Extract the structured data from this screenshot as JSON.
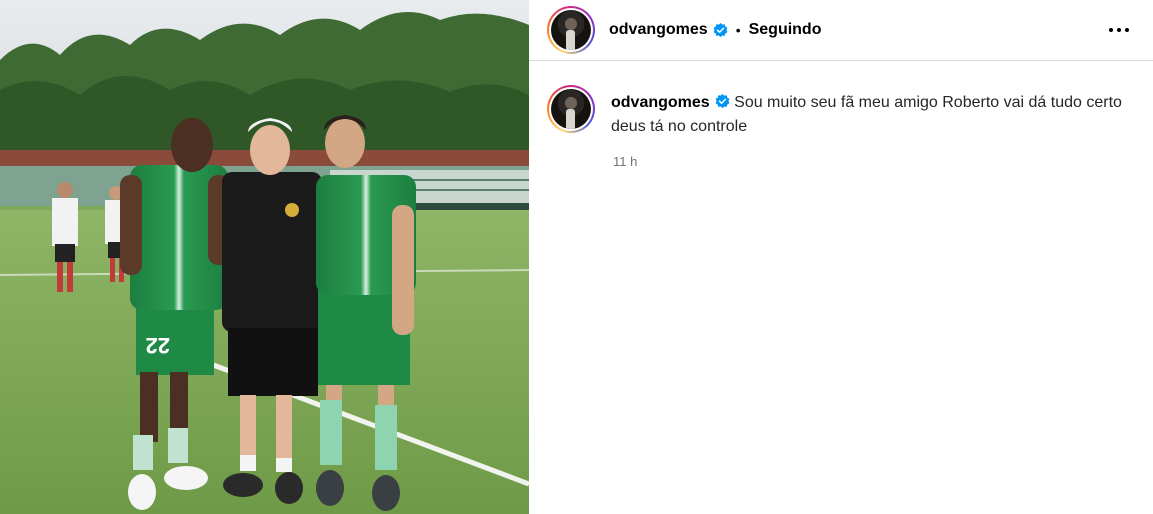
{
  "post": {
    "author": "odvangomes",
    "follow_status": "Seguindo",
    "separator": "•"
  },
  "caption": {
    "author": "odvangomes",
    "text": "Sou muito seu fã meu amigo Roberto vai dá tudo certo deus tá no controle",
    "time": "11 h"
  },
  "photo": {
    "description_icon": "soccer-players-photo",
    "jersey_number": "22"
  },
  "colors": {
    "verified": "#0095f6",
    "jersey_green": "#1f8a45",
    "grass": "#7fa95a"
  }
}
